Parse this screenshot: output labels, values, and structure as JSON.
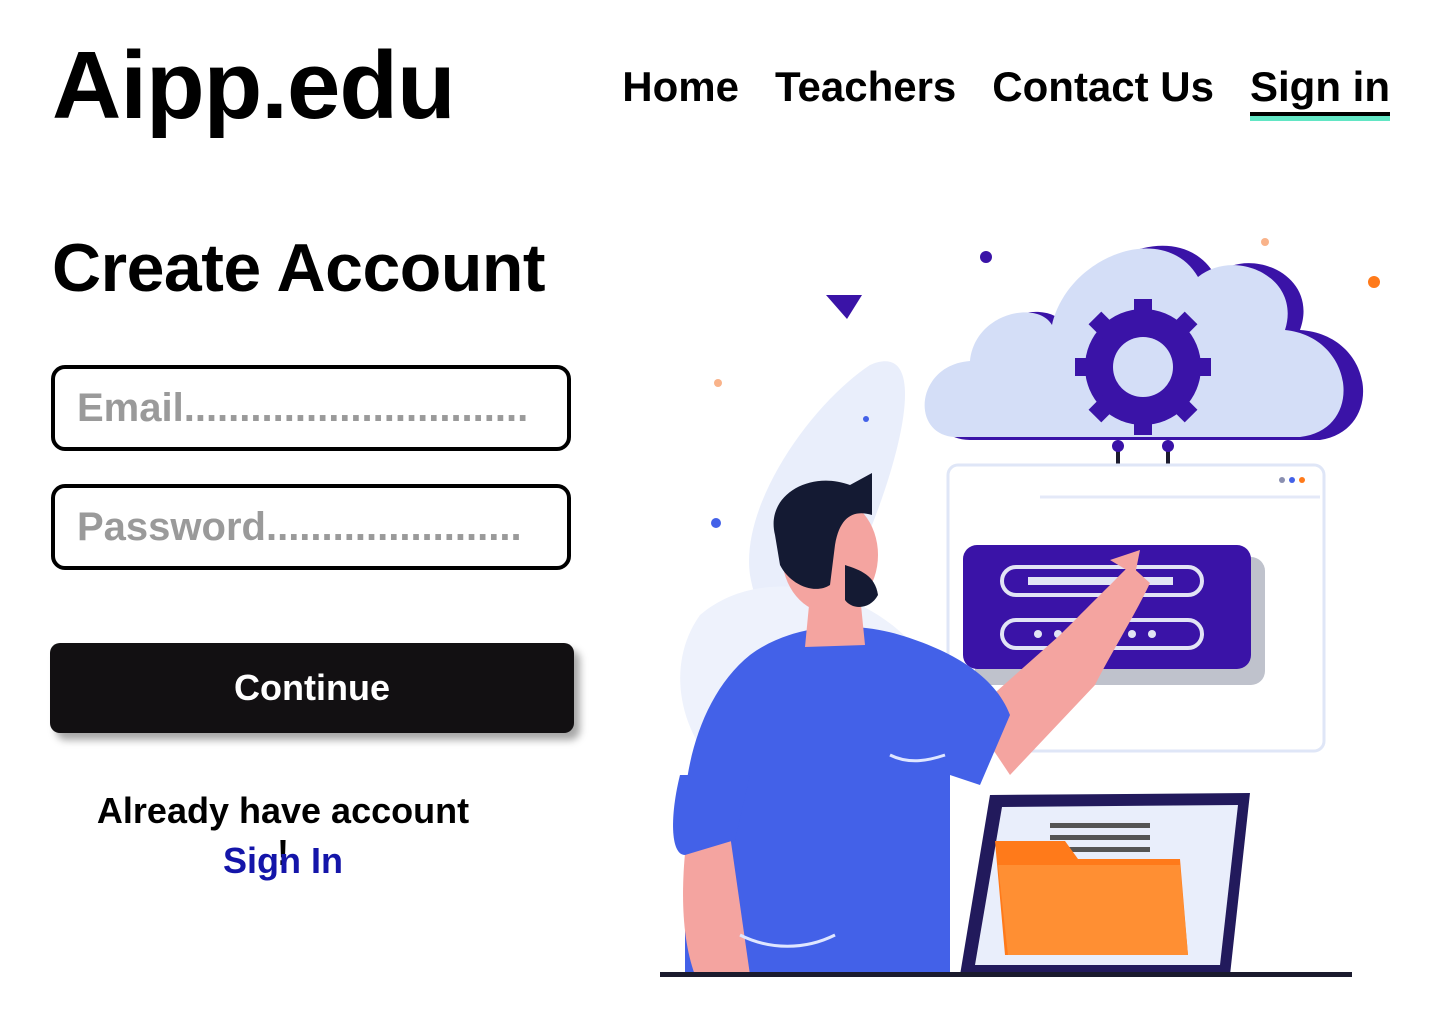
{
  "brand": {
    "logo": "Aipp.edu"
  },
  "nav": {
    "items": [
      {
        "label": "Home"
      },
      {
        "label": "Teachers"
      },
      {
        "label": "Contact Us"
      },
      {
        "label": "Sign in",
        "active": true
      }
    ],
    "active_underline_color": "#62e6c4"
  },
  "form": {
    "title": "Create Account",
    "email_placeholder": "Email...............................",
    "password_placeholder": "Password.......................",
    "continue_label": "Continue",
    "already_text": "Already have account !",
    "signin_label": "Sign In"
  },
  "colors": {
    "button_bg": "#121012",
    "link": "#1415a9",
    "illustration_primary": "#3a13a7",
    "illustration_shirt": "#4361e8",
    "illustration_folder": "#ff7a1a"
  },
  "icons": [
    "cloud-gear-icon",
    "login-panel-icon",
    "folder-icon"
  ]
}
